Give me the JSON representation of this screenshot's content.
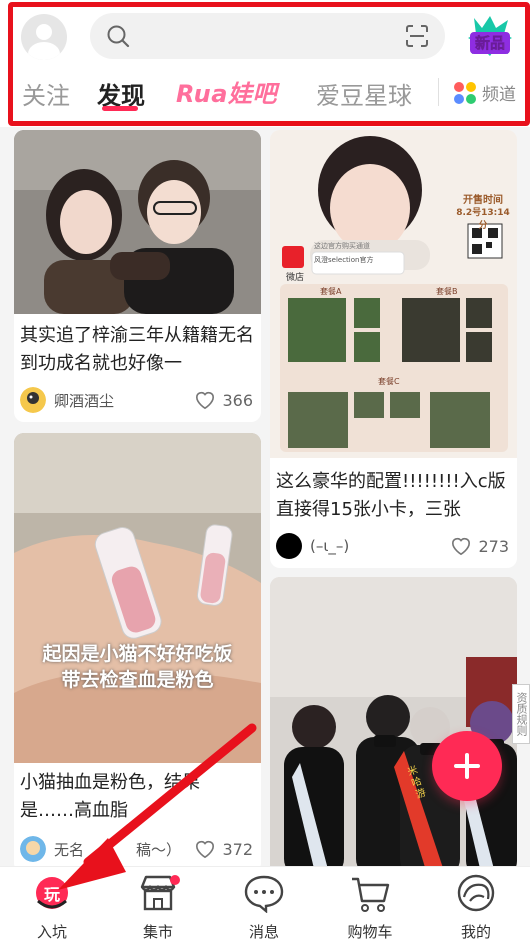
{
  "header": {
    "tabs": [
      {
        "label": "关注",
        "active": false
      },
      {
        "label": "发现",
        "active": true
      },
      {
        "label": "Rua娃吧",
        "active": false
      },
      {
        "label": "爱豆星球",
        "active": false
      }
    ],
    "new_badge": "新品",
    "channel_label": "频道"
  },
  "feed": {
    "left": [
      {
        "title": "其实追了梓渝三年从籍籍无名到功成名就也好像一",
        "author": "卿酒酒尘",
        "likes": "366"
      },
      {
        "overlay_text_line1": "起因是小猫不好好吃饭",
        "overlay_text_line2": "带去检查血是粉色",
        "title_line1": "小猫抽血是粉色，结果",
        "title_line2": "是……高血脂",
        "author": "无名",
        "author_suffix": "稿～）",
        "likes": "372"
      }
    ],
    "right": [
      {
        "poster_sale_title": "开售时间",
        "poster_sale_time": "8.2号13:14分",
        "poster_store": "微店",
        "poster_store_name": "风澄selection官方",
        "poster_store_sub": "这边官方购买通道",
        "poster_labels": [
          "套餐A",
          "套餐B",
          "套餐C"
        ],
        "title": "这么豪华的配置!!!!!!!!入c版直接得15张小卡，三张",
        "author": "(–ι_–)",
        "likes": "273"
      },
      {
        "sash_text": "米哈游"
      }
    ]
  },
  "side_tag": "资质规则",
  "bottom_nav": [
    {
      "label": "入坑",
      "icon": "play-icon",
      "active": true,
      "icon_text": "玩"
    },
    {
      "label": "集市",
      "icon": "market-icon",
      "badge": true
    },
    {
      "label": "消息",
      "icon": "message-icon"
    },
    {
      "label": "购物车",
      "icon": "cart-icon"
    },
    {
      "label": "我的",
      "icon": "profile-icon"
    }
  ],
  "colors": {
    "accent": "#ff2a55",
    "highlight_frame": "#e8111c",
    "rua_pink": "#ff6f9c"
  }
}
